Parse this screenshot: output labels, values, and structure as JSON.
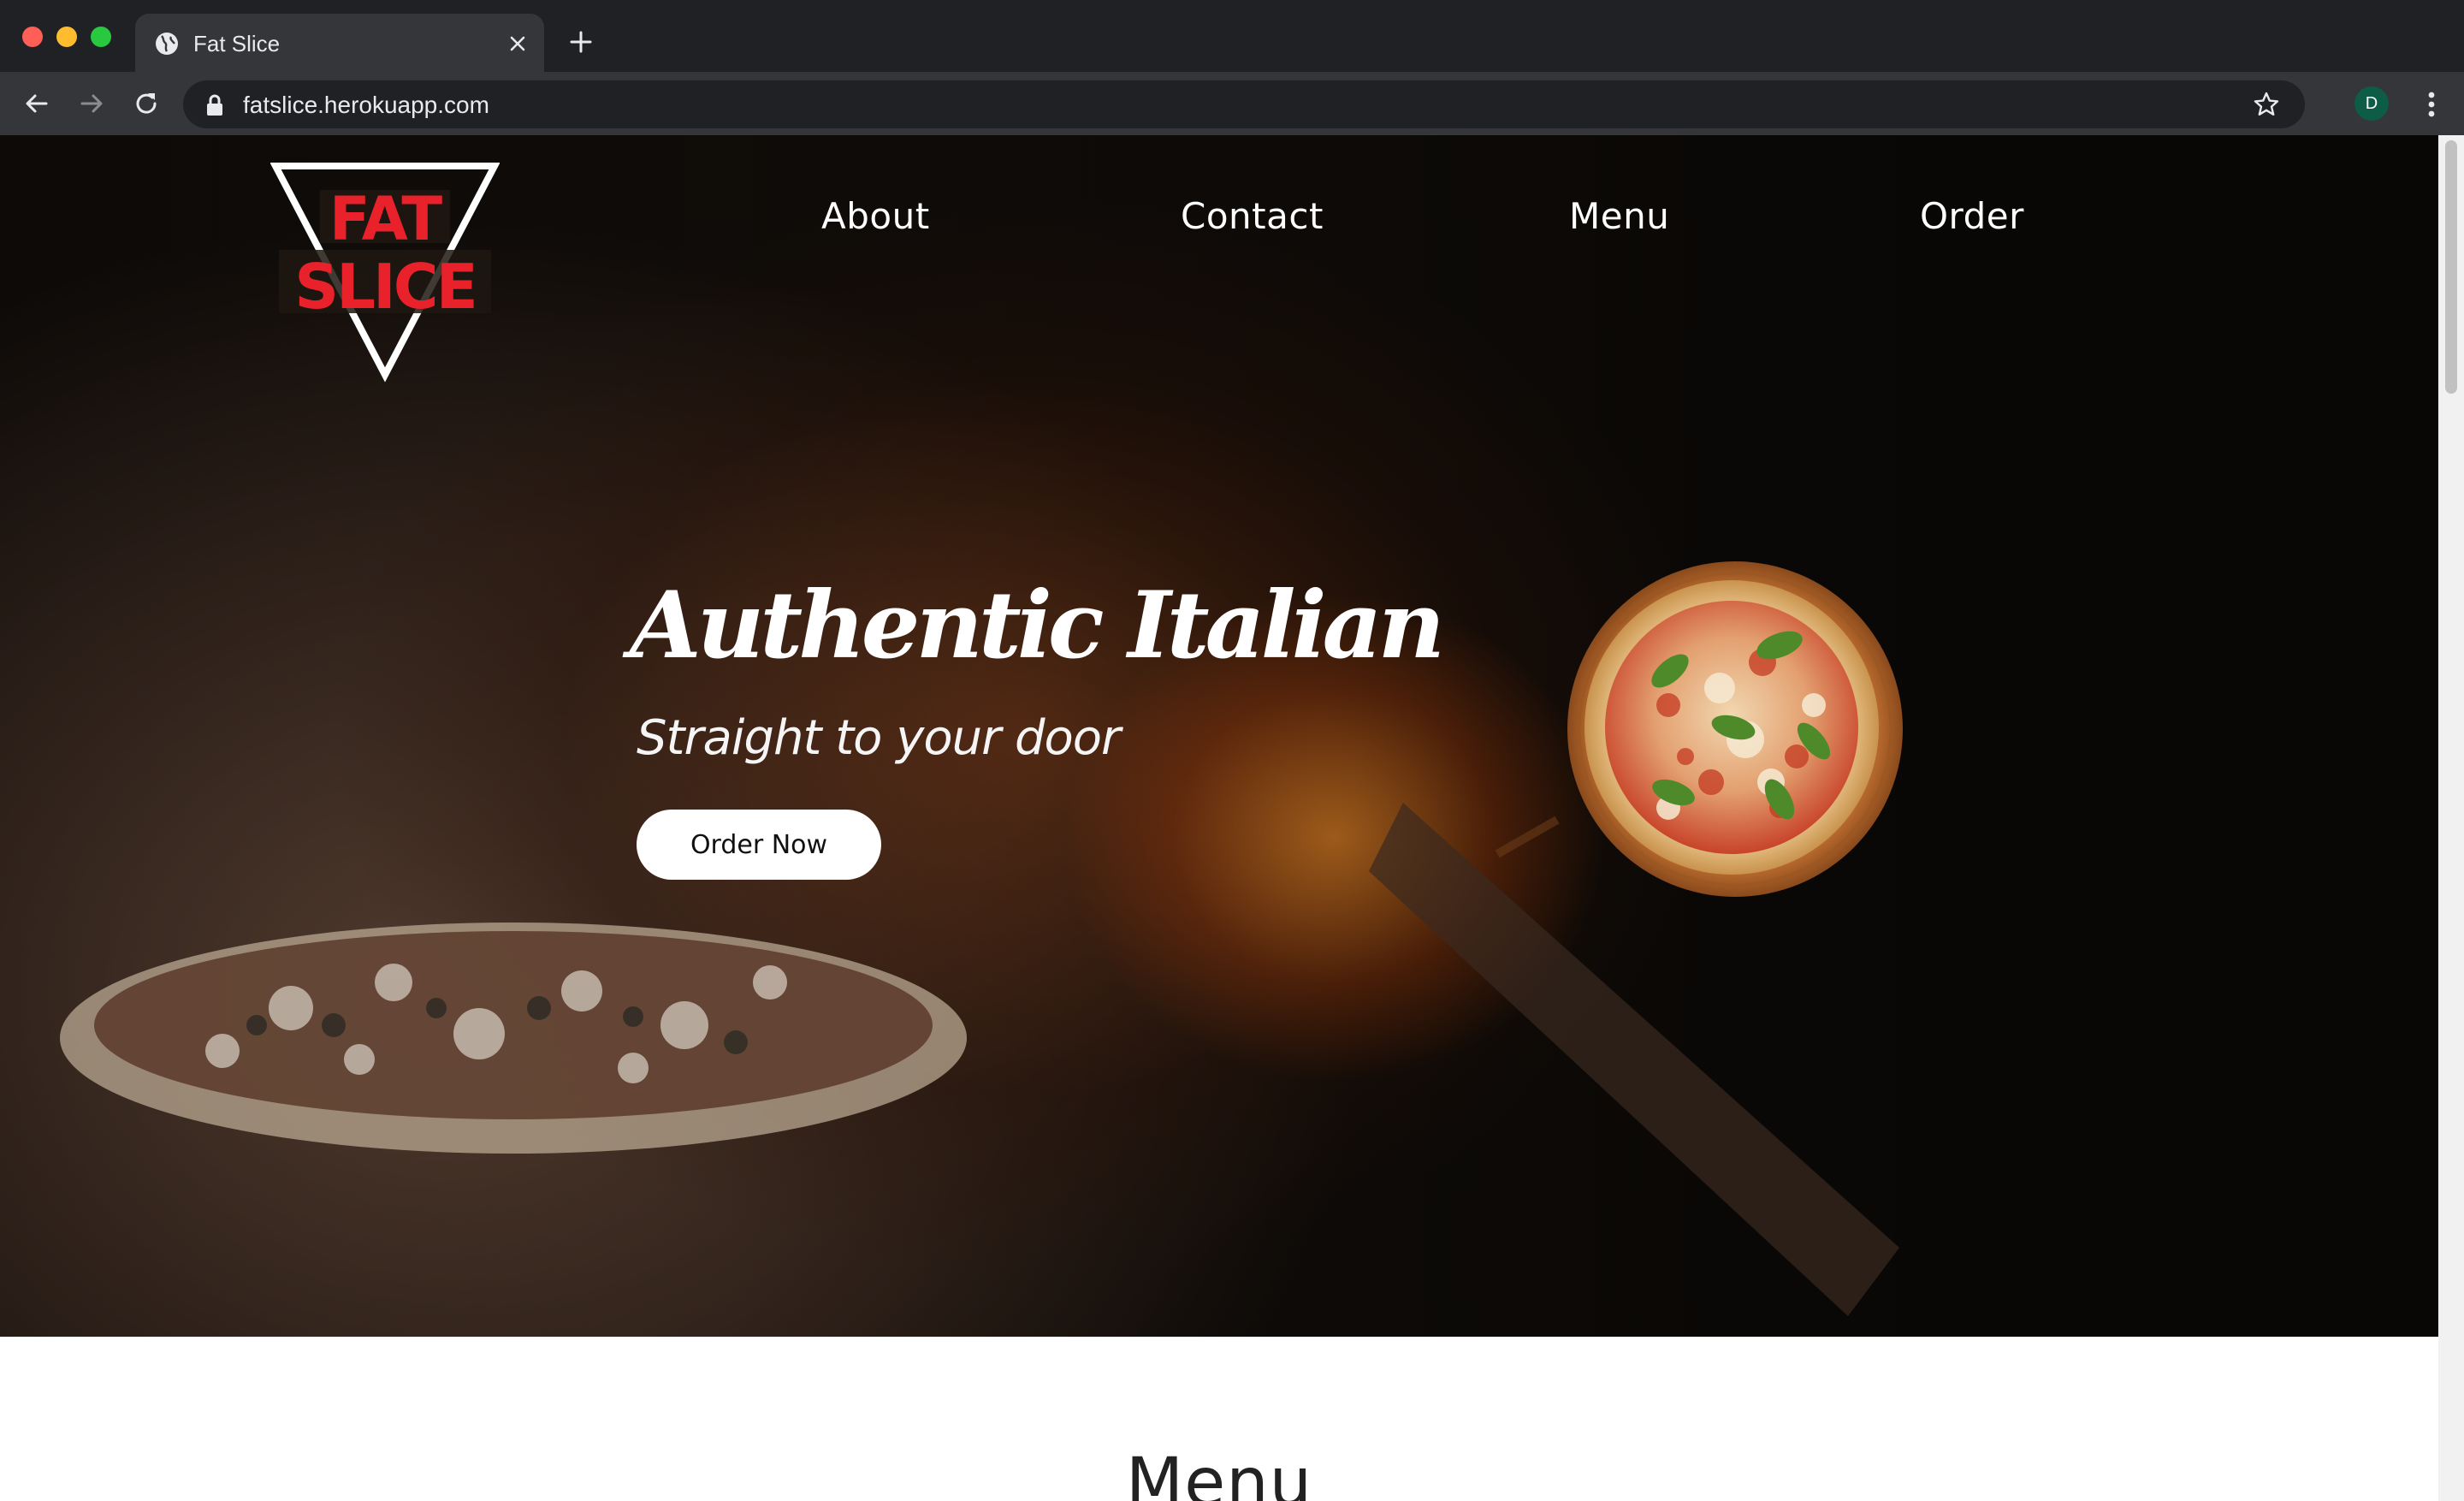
{
  "browser": {
    "tab_title": "Fat Slice",
    "url": "fatslice.herokuapp.com",
    "profile_initial": "D"
  },
  "site": {
    "logo_text": [
      "FAT",
      "SLICE"
    ],
    "logo_color": "#e8212a",
    "nav": [
      {
        "label": "About"
      },
      {
        "label": "Contact"
      },
      {
        "label": "Menu"
      },
      {
        "label": "Order"
      }
    ],
    "hero": {
      "title": "Authentic Italian",
      "subtitle": "Straight to your door",
      "cta_label": "Order Now"
    },
    "menu_section": {
      "heading": "Menu"
    }
  }
}
